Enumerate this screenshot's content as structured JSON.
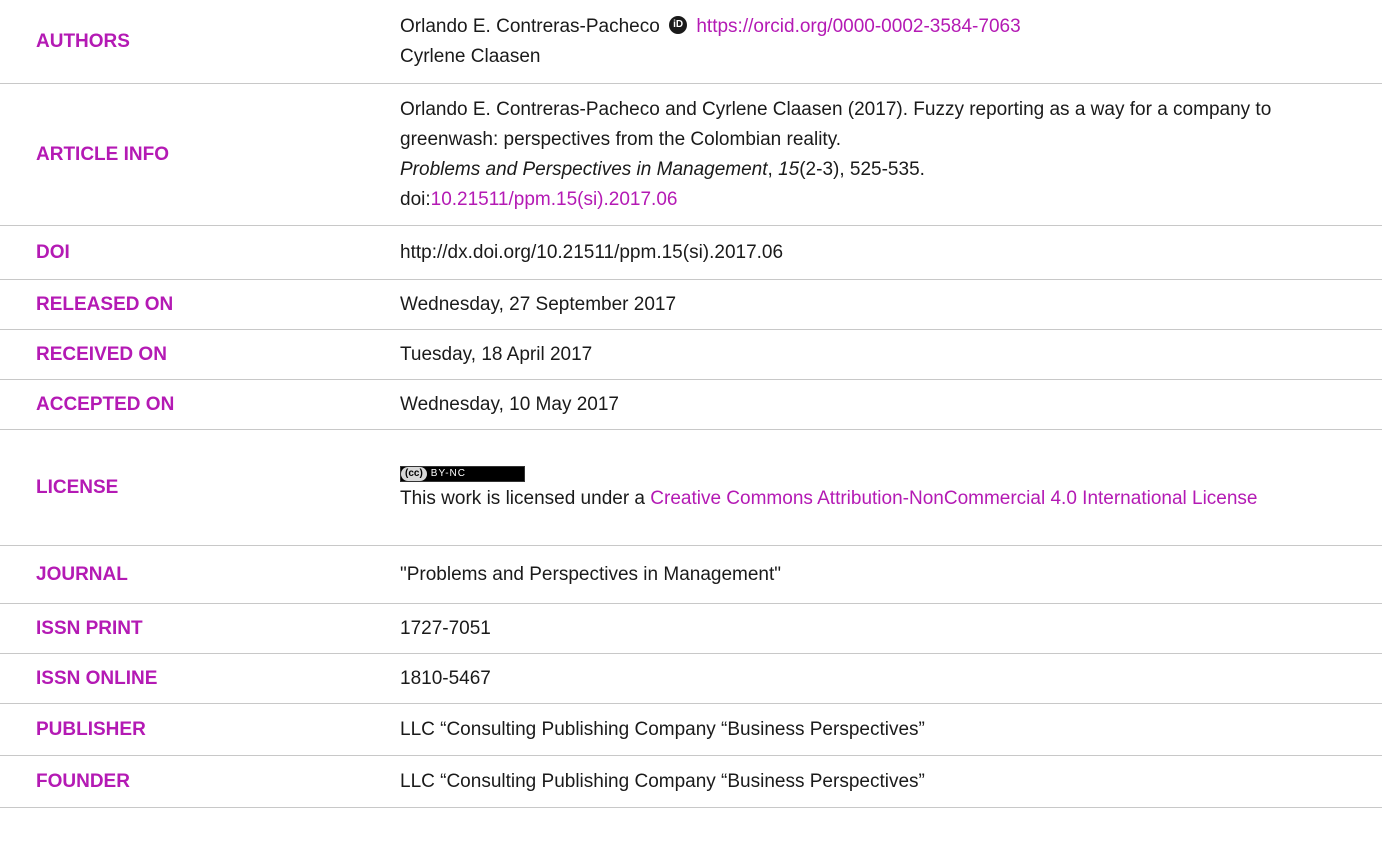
{
  "rows": {
    "authors": {
      "label": "AUTHORS",
      "author1": "Orlando E. Contreras-Pacheco",
      "orcid_url": "https://orcid.org/0000-0002-3584-7063",
      "author2": "Cyrlene Claasen"
    },
    "article_info": {
      "label": "ARTICLE INFO",
      "citation_part1": "Orlando E. Contreras-Pacheco and Cyrlene Claasen (2017). Fuzzy reporting as a way for a company to greenwash: perspectives from the Colombian reality.",
      "journal_italic": "Problems and Perspectives in Management",
      "sep1": ", ",
      "volume_italic": "15",
      "issue_pages": "(2-3), 525-535.",
      "doi_prefix": "doi:",
      "doi_link": "10.21511/ppm.15(si).2017.06"
    },
    "doi": {
      "label": "DOI",
      "value": "http://dx.doi.org/10.21511/ppm.15(si).2017.06"
    },
    "released_on": {
      "label": "RELEASED ON",
      "value": "Wednesday, 27 September 2017"
    },
    "received_on": {
      "label": "RECEIVED ON",
      "value": "Tuesday, 18 April 2017"
    },
    "accepted_on": {
      "label": "ACCEPTED ON",
      "value": "Wednesday, 10 May 2017"
    },
    "license": {
      "label": "LICENSE",
      "badge_cc": "(cc)",
      "badge_by": "BY-NC",
      "text_prefix": "This work is licensed under a ",
      "link_text": "Creative Commons Attribution-NonCommercial 4.0 International License"
    },
    "journal": {
      "label": "JOURNAL",
      "value": "\"Problems and Perspectives in Management\""
    },
    "issn_print": {
      "label": "ISSN PRINT",
      "value": "1727-7051"
    },
    "issn_online": {
      "label": "ISSN ONLINE",
      "value": "1810-5467"
    },
    "publisher": {
      "label": "PUBLISHER",
      "value": "LLC “Consulting Publishing Company “Business Perspectives”"
    },
    "founder": {
      "label": "FOUNDER",
      "value": "LLC “Consulting Publishing Company “Business Perspectives”"
    }
  },
  "colors": {
    "label": "#b41ab4",
    "link": "#b41ab4",
    "text": "#1a1a1a",
    "divider": "#c8c8c8"
  },
  "icons": {
    "orcid": "orcid-icon",
    "cc_license": "cc-license-icon"
  }
}
